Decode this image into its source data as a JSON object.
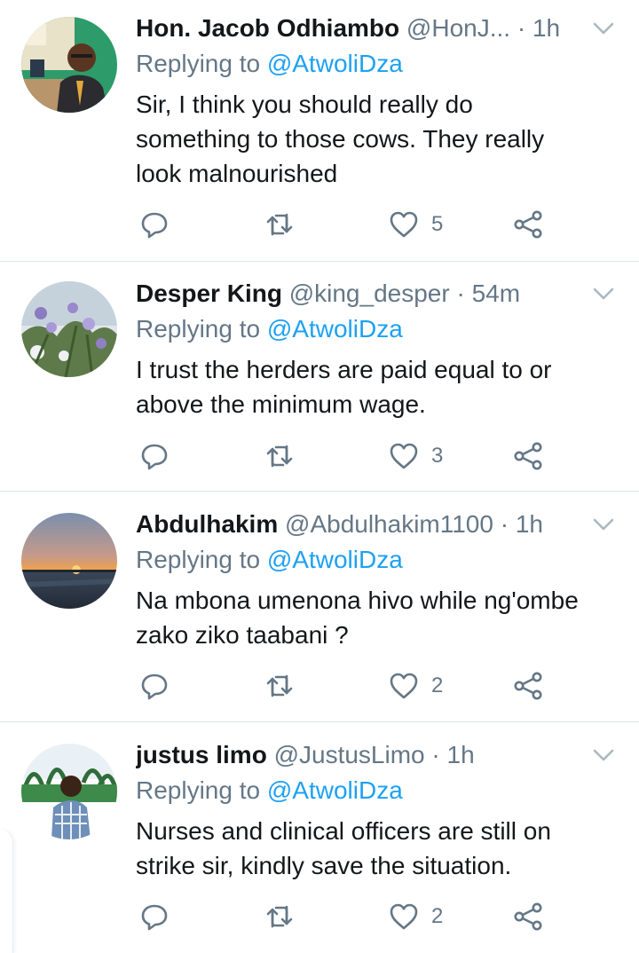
{
  "colors": {
    "accent": "#1da1f2",
    "muted": "#657786",
    "text": "#14171a"
  },
  "tweets": [
    {
      "name": "Hon. Jacob Odhiambo",
      "handle": "@HonJ...",
      "time": "· 1h",
      "reply_prefix": "Replying to",
      "mention": "@AtwoliDza",
      "text": "Sir, I think you should really do\nsomething to those cows. They really\nlook malnourished",
      "likes": "5"
    },
    {
      "name": "Desper King",
      "handle": "@king_desper",
      "time": "· 54m",
      "reply_prefix": "Replying to",
      "mention": "@AtwoliDza",
      "text": "I trust the herders are paid equal to or\nabove the minimum wage.",
      "likes": "3"
    },
    {
      "name": "Abdulhakim",
      "handle": "@Abdulhakim1100",
      "time": "· 1h",
      "reply_prefix": "Replying to",
      "mention": "@AtwoliDza",
      "text": "Na mbona umenona hivo while ng'ombe\nzako ziko taabani ?",
      "likes": "2"
    },
    {
      "name": "justus limo",
      "handle": "@JustusLimo",
      "time": "· 1h",
      "reply_prefix": "Replying to",
      "mention": "@AtwoliDza",
      "text": "Nurses and clinical officers are still on\nstrike sir, kindly save the situation.",
      "likes": "2"
    }
  ]
}
